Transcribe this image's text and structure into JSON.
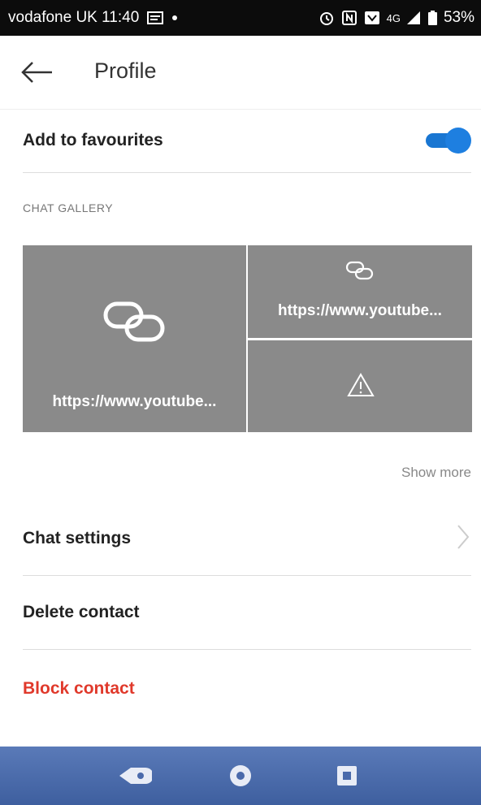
{
  "status_bar": {
    "carrier_time": "vodafone UK 11:40",
    "network": "4G",
    "battery": "53%",
    "icons": [
      "message-icon",
      "dot-icon",
      "alarm-icon",
      "nfc-icon",
      "data-saver-icon",
      "signal-icon",
      "battery-icon"
    ]
  },
  "header": {
    "title": "Profile",
    "back_icon": "back-arrow-icon"
  },
  "favourites": {
    "label": "Add to favourites",
    "enabled": true,
    "toggle_color": "#1976d2"
  },
  "gallery": {
    "section_label": "CHAT GALLERY",
    "tiles": [
      {
        "type": "link",
        "text": "https://www.youtube...",
        "icon": "link-icon"
      },
      {
        "type": "link",
        "text": "https://www.youtube...",
        "icon": "link-icon"
      },
      {
        "type": "error",
        "text": "",
        "icon": "warning-icon"
      }
    ],
    "show_more": "Show more"
  },
  "menu": {
    "chat_settings": "Chat settings",
    "delete_contact": "Delete contact",
    "block_contact": "Block contact",
    "block_color": "#e0392b"
  },
  "nav_bar": {
    "buttons": [
      "back-nav-icon",
      "home-icon",
      "recents-icon"
    ]
  }
}
